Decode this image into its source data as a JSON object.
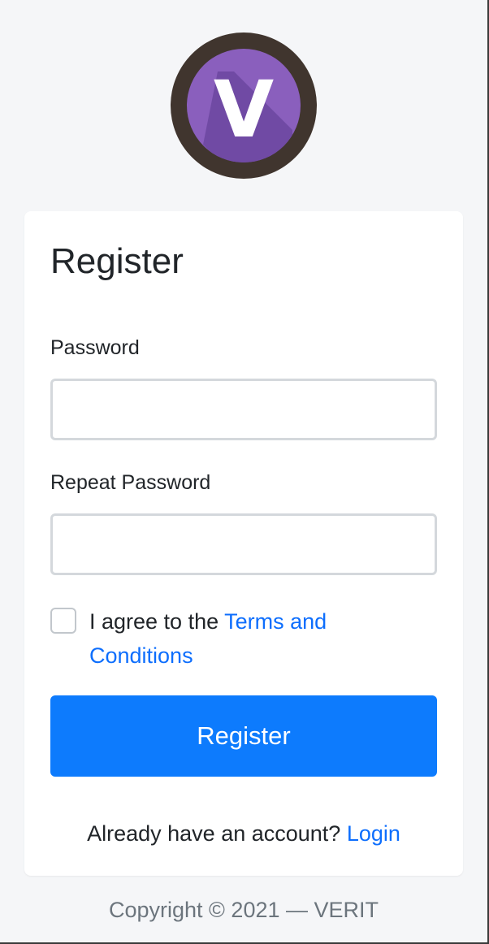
{
  "logo": {
    "letter": "V",
    "ring_color": "#40352e",
    "fill_color": "#8a5fbd",
    "shadow_color": "#6b47a0"
  },
  "form": {
    "title": "Register",
    "password_label": "Password",
    "password_value": "",
    "repeat_password_label": "Repeat Password",
    "repeat_password_value": "",
    "agree_prefix": "I agree to the ",
    "agree_link": "Terms and Conditions",
    "agree_checked": false,
    "submit_label": "Register",
    "login_prompt": "Already have an account? ",
    "login_link": "Login"
  },
  "footer": {
    "copyright": "Copyright © 2021 — VERIT"
  },
  "colors": {
    "primary": "#0d7bfd",
    "link": "#0d6efd",
    "background": "#f5f6f8"
  }
}
